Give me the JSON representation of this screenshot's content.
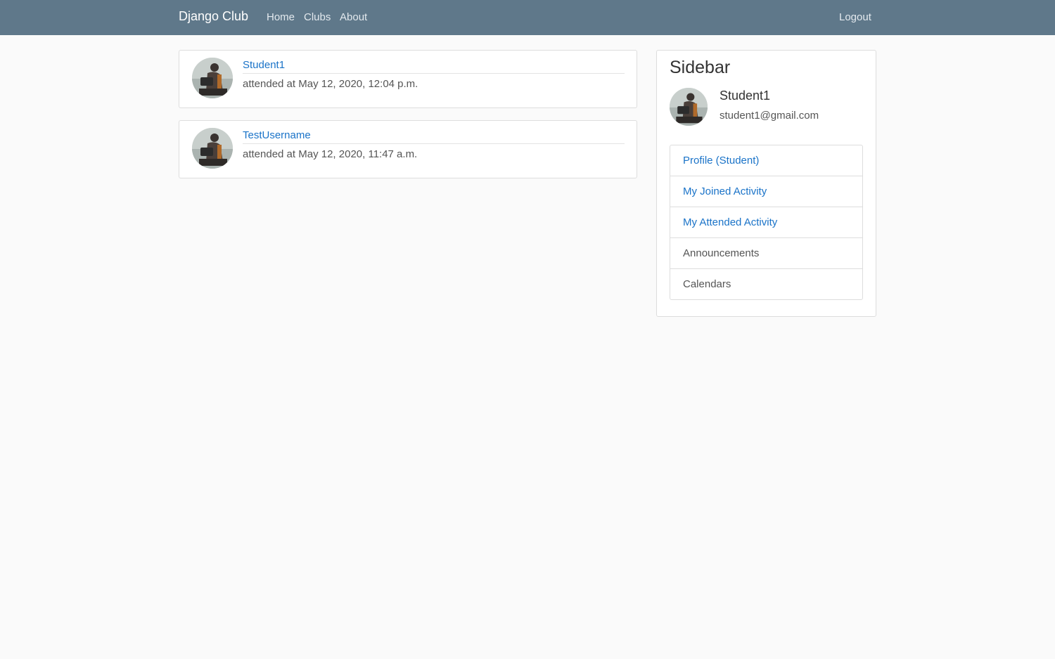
{
  "navbar": {
    "brand": "Django Club",
    "links": [
      "Home",
      "Clubs",
      "About"
    ],
    "logout": "Logout"
  },
  "feed": [
    {
      "author": "Student1",
      "text": "attended at May 12, 2020, 12:04 p.m."
    },
    {
      "author": "TestUsername",
      "text": "attended at May 12, 2020, 11:47 a.m."
    }
  ],
  "sidebar": {
    "title": "Sidebar",
    "user_name": "Student1",
    "user_email": "student1@gmail.com",
    "items": [
      {
        "label": "Profile (Student)"
      },
      {
        "label": "My Joined Activity"
      },
      {
        "label": "My Attended Activity"
      },
      {
        "label": "Announcements"
      },
      {
        "label": "Calendars"
      }
    ]
  },
  "colors": {
    "navbar": "#5f788a",
    "link": "#1a73c8",
    "background": "#fafafa"
  }
}
